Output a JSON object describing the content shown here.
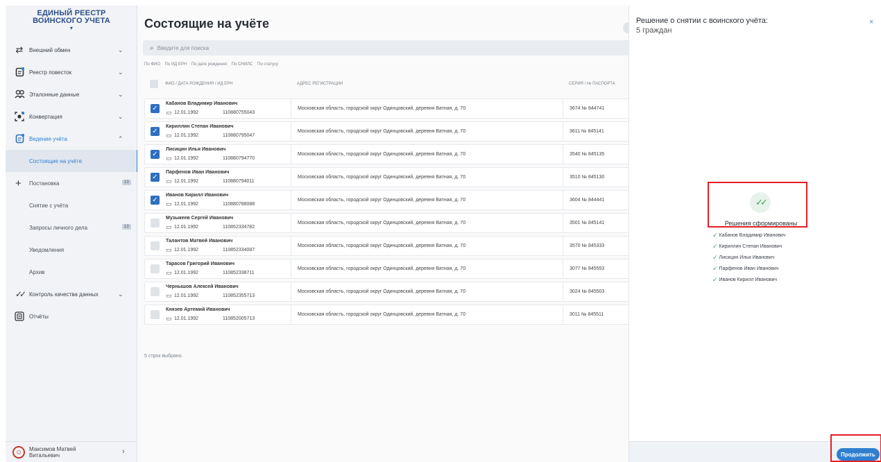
{
  "app": {
    "logo_line1": "ЕДИНЫЙ РЕЕСТР",
    "logo_line2": "ВОИНСКОГО УЧЕТА"
  },
  "sidebar": {
    "items": [
      {
        "label": "Внешний обмен",
        "icon": "exchange-icon"
      },
      {
        "label": "Реестр повесток",
        "icon": "document-icon"
      },
      {
        "label": "Эталонные данные",
        "icon": "group-icon"
      },
      {
        "label": "Конвертация",
        "icon": "convert-icon"
      },
      {
        "label": "Ведение учёта",
        "icon": "records-icon"
      }
    ],
    "subitems": [
      {
        "label": "Состоящие на учёте"
      },
      {
        "label": "Постановка",
        "badge": "13"
      },
      {
        "label": "Снятие с учёта"
      },
      {
        "label": "Запросы личного дела",
        "badge": "13"
      },
      {
        "label": "Уведомления"
      },
      {
        "label": "Архив"
      }
    ],
    "items2": [
      {
        "label": "Контроль качества данных",
        "icon": "double-check-icon"
      },
      {
        "label": "Отчёты",
        "icon": "reports-icon"
      }
    ],
    "user": {
      "line1": "Максимов Матвей",
      "line2": "Витальевич"
    }
  },
  "main": {
    "title": "Состоящие на учёте",
    "search_placeholder": "Введите для поиска",
    "filters": [
      "По ФИО",
      "По ИД ЕРН",
      "По дате рождения",
      "По СНИЛС",
      "По статусу"
    ],
    "headers": {
      "name": "ФИО / ДАТА РОЖДЕНИЯ / ИД ЕРН",
      "address": "АДРЕС РЕГИСТРАЦИИ",
      "passport": "СЕРИЯ / № ПАСПОРТА"
    },
    "rows": [
      {
        "name": "Кабанов Владимир Иванович",
        "dob": "12.01.1992",
        "ern": "110880755043",
        "address": "Московская область, городской округ Одинцовский, деревня Ватная, д. 70",
        "passport": "3674 № 844741",
        "checked": true
      },
      {
        "name": "Кириллин Степан Иванович",
        "dob": "12.01.1992",
        "ern": "110880795047",
        "address": "Московская область, городской округ Одинцовский, деревня Ватная, д. 70",
        "passport": "3611 № 845141",
        "checked": true
      },
      {
        "name": "Лисицин Илья Иванович",
        "dob": "12.01.1992",
        "ern": "110880794770",
        "address": "Московская область, городской округ Одинцовский, деревня Ватная, д. 70",
        "passport": "3540 № 845135",
        "checked": true
      },
      {
        "name": "Парфенов Иван Иванович",
        "dob": "12.01.1992",
        "ern": "110880794011",
        "address": "Московская область, городской округ Одинцовский, деревня Ватная, д. 70",
        "passport": "3510 № 845130",
        "checked": true
      },
      {
        "name": "Иванов Кирилл Иванович",
        "dob": "12.01.1992",
        "ern": "110880788088",
        "address": "Московская область, городской округ Одинцовский, деревня Ватная, д. 70",
        "passport": "3604 № 844441",
        "checked": true
      },
      {
        "name": "Музыкеев Сергей Иванович",
        "dob": "12.01.1992",
        "ern": "110852334782",
        "address": "Московская область, городской округ Одинцовский, деревня Ватная, д. 70",
        "passport": "3501 № 845141",
        "checked": false
      },
      {
        "name": "Талантов Матвей Иванович",
        "dob": "12.01.1992",
        "ern": "110852334087",
        "address": "Московская область, городской округ Одинцовский, деревня Ватная, д. 70",
        "passport": "3570 № 845333",
        "checked": false
      },
      {
        "name": "Тарасов Григорий Иванович",
        "dob": "12.01.1992",
        "ern": "110852338711",
        "address": "Московская область, городской округ Одинцовский, деревня Ватная, д. 70",
        "passport": "3077 № 845553",
        "checked": false
      },
      {
        "name": "Чернышов Алексей Иванович",
        "dob": "12.01.1992",
        "ern": "110852355713",
        "address": "Московская область, городской округ Одинцовский, деревня Ватная, д. 70",
        "passport": "3024 № 845503",
        "checked": false
      },
      {
        "name": "Князев Артемий Иванович",
        "dob": "12.01.1992",
        "ern": "110852005713",
        "address": "Московская область, городской округ Одинцовский, деревня Ватная, д. 70",
        "passport": "3011 № 845511",
        "checked": false
      }
    ],
    "selected_text": "5 строк выбрано."
  },
  "panel": {
    "title": "Решение о снятии с воинского учёта:",
    "subtitle": "5 граждан",
    "success_title": "Решения сформированы",
    "people": [
      "Кабанов Владимир Иванович",
      "Кириллин Степан Иванович",
      "Лисицин Илья Иванович",
      "Парфенов Иван Иванович",
      "Иванов Кирилл Иванович"
    ],
    "continue_label": "Продолжить",
    "close_symbol": "×"
  },
  "colors": {
    "accent": "#2d7fd3",
    "checkbox": "#2d6fc0",
    "success": "#3aa35a",
    "highlight": "#e31e24"
  }
}
